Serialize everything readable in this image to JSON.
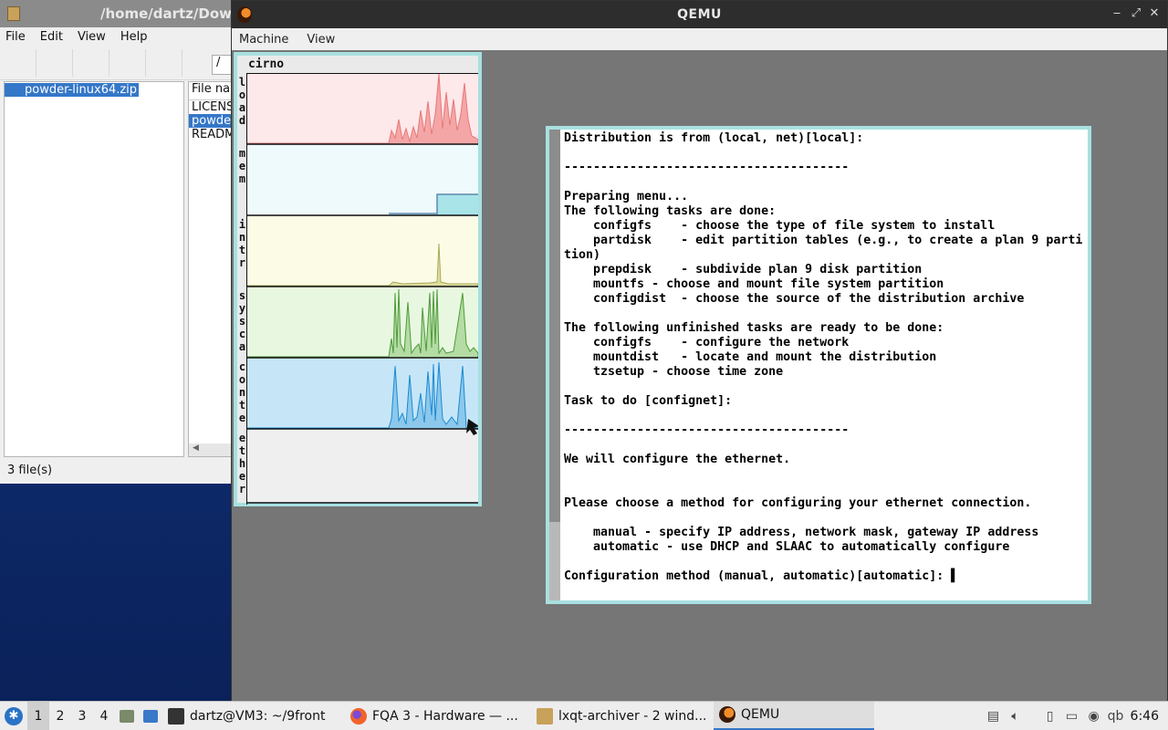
{
  "archiver": {
    "title": "/home/dartz/Dow",
    "menu": [
      "File",
      "Edit",
      "View",
      "Help"
    ],
    "path": "/",
    "tree_item": "powder-linux64.zip",
    "files_header": "File nar",
    "files": [
      "LICENS",
      "powder",
      "READM"
    ],
    "status": "3 file(s)"
  },
  "qemu": {
    "title": "QEMU",
    "menu": [
      "Machine",
      "View"
    ],
    "stats": {
      "host": "cirno",
      "labels": [
        "load",
        "mem",
        "intr",
        "sysca",
        "conte",
        "ether"
      ]
    },
    "console_lines": [
      "Distribution is from (local, net)[local]:",
      "",
      "---------------------------------------",
      "",
      "Preparing menu...",
      "The following tasks are done:",
      "    configfs    - choose the type of file system to install",
      "    partdisk    - edit partition tables (e.g., to create a plan 9 parti",
      "tion)",
      "    prepdisk    - subdivide plan 9 disk partition",
      "    mountfs - choose and mount file system partition",
      "    configdist  - choose the source of the distribution archive",
      "",
      "The following unfinished tasks are ready to be done:",
      "    configfs    - configure the network",
      "    mountdist   - locate and mount the distribution",
      "    tzsetup - choose time zone",
      "",
      "Task to do [confignet]:",
      "",
      "---------------------------------------",
      "",
      "We will configure the ethernet.",
      "",
      "",
      "Please choose a method for configuring your ethernet connection.",
      "",
      "    manual - specify IP address, network mask, gateway IP address",
      "    automatic - use DHCP and SLAAC to automatically configure",
      "",
      "Configuration method (manual, automatic)[automatic]: ▌"
    ]
  },
  "taskbar": {
    "workspaces": [
      "1",
      "2",
      "3",
      "4"
    ],
    "tasks": [
      {
        "label": "dartz@VM3: ~/9front",
        "icon": "terminal-icon"
      },
      {
        "label": "FQA 3 - Hardware — ...",
        "icon": "firefox-icon"
      },
      {
        "label": "lxqt-archiver - 2 wind...",
        "icon": "archiver-icon"
      },
      {
        "label": "QEMU",
        "icon": "qemu-icon"
      }
    ],
    "clock": "6:46",
    "keyboard": "qb"
  },
  "colors": {
    "load": "#e87878",
    "mem": "#6dc8cc",
    "intr": "#a8a860",
    "sysca": "#4e9a3a",
    "conte": "#1a8ad0",
    "accent": "#3477c8"
  }
}
